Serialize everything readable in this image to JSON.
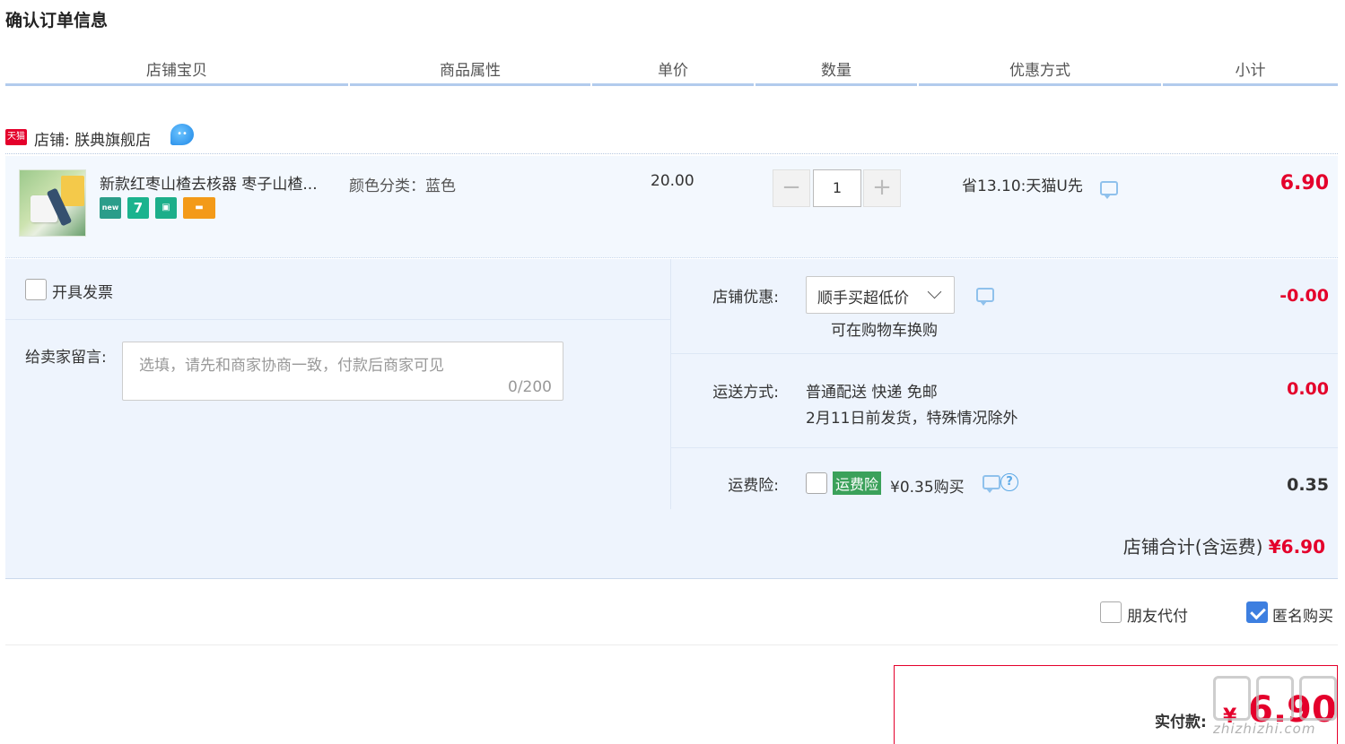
{
  "page": {
    "title": "确认订单信息"
  },
  "columns": [
    "店铺宝贝",
    "商品属性",
    "单价",
    "数量",
    "优惠方式",
    "小计"
  ],
  "shop": {
    "badge": "天猫",
    "label": "店铺: 朕典旗舰店"
  },
  "item": {
    "title": "新款红枣山楂去核器 枣子山楂...",
    "attribute": "颜色分类：蓝色",
    "unit_price": "20.00",
    "quantity": "1",
    "qty_minus": "−",
    "qty_plus": "+",
    "promo": "省13.10:天猫U先",
    "subtotal": "6.90",
    "service_icons": [
      "new-icon",
      "7-day-return-icon",
      "guarantee-icon",
      "card-icon"
    ]
  },
  "invoice": {
    "label": "开具发票",
    "checked": false
  },
  "memo": {
    "label": "给卖家留言:",
    "placeholder": "选填，请先和商家协商一致，付款后商家可见",
    "count": "0/200"
  },
  "shop_discount": {
    "label": "店铺优惠:",
    "selected": "顺手买超低价",
    "note": "可在购物车换购",
    "amount": "-0.00"
  },
  "shipping": {
    "label": "运送方式:",
    "method": "普通配送 快递 免邮",
    "note": "2月11日前发货，特殊情况除外",
    "amount": "0.00"
  },
  "insurance": {
    "label": "运费险:",
    "tag": "运费险",
    "price": "¥0.35购买",
    "help": "?",
    "amount": "0.35",
    "checked": false
  },
  "shop_total": {
    "label": "店铺合计(含运费)",
    "amount": "¥6.90"
  },
  "options": {
    "friend_pay": "朋友代付",
    "friend_pay_checked": false,
    "anonymous": "匿名购买",
    "anonymous_checked": true
  },
  "payment": {
    "label": "实付款:",
    "currency": "¥",
    "amount": "6.90"
  },
  "watermark": {
    "text": "zhizhizhi.com"
  },
  "colors": {
    "accent_red": "#e4002b",
    "header_rule": "#b2cbed",
    "panel_bg": "#eef4fd",
    "check_blue": "#3d7fe0",
    "insurance_green": "#3ba15a"
  }
}
